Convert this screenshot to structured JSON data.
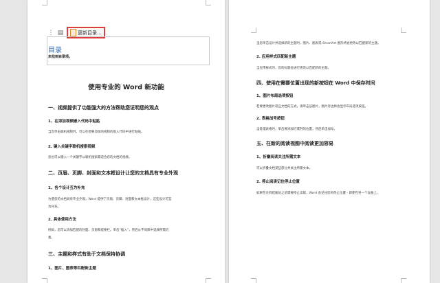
{
  "toc_toolbar": {
    "update_button_label": "更新目录..."
  },
  "toc": {
    "title": "目录",
    "empty_message": "未找到目录项。"
  },
  "left_page": {
    "doc_title": "使用专业的 Word 新功能",
    "lines": [
      {
        "type": "h1",
        "text": "一、视频提供了功能强大的方法帮助您证明您的观点"
      },
      {
        "type": "h2",
        "text": "1、在添加视频嵌入代码中粘贴"
      },
      {
        "type": "p",
        "text": "当您单击联机视频时，可以在想要添加的视频的嵌入代码中进行粘贴。"
      },
      {
        "type": "h2",
        "text": "2. 键入关键字联机搜索视频"
      },
      {
        "type": "p",
        "text": "您也可以键入一个关键字以联机搜索最适合您的文档的视频。"
      },
      {
        "type": "h1",
        "text": "二、页眉、页脚、封面和文本框设计让您的文档具有专业外观"
      },
      {
        "type": "h2",
        "text": "1、各个设计互为补充"
      },
      {
        "type": "p",
        "text": "为使您的文档具有专业外观，Word 提供了页眉、页脚、封面和文本框设计，这些设计可互"
      },
      {
        "type": "p",
        "text": "为补充。"
      },
      {
        "type": "h2",
        "text": "2. 具体使用方法"
      },
      {
        "type": "p",
        "text": "例如，您可以添加匹配的封面、页眉和提要栏。单击“插入”，然后从不同库中选择所需元"
      },
      {
        "type": "p",
        "text": "素。"
      },
      {
        "type": "h1",
        "text": "三、主题和样式有助于文档保持协调"
      },
      {
        "type": "h2",
        "text": "1、图片、图表等匹配新主题"
      }
    ]
  },
  "right_page": {
    "lines": [
      {
        "type": "p",
        "text": "当您单击设计并选择新的主题时，图片、图表或 SmartArt 图形将会更改以匹配新的主题。"
      },
      {
        "type": "h2",
        "text": "2. 应用样式匹配新主题"
      },
      {
        "type": "p",
        "text": "当应用样式时，您的标题会进行更改以匹配新的主题。"
      },
      {
        "type": "h1",
        "text": "四、使用在需要位置出现的新按钮在 Word 中保存时间"
      },
      {
        "type": "h2",
        "text": "1、图片布局选项按钮"
      },
      {
        "type": "p",
        "text": "若要更改图片适应文档的方式，请单击该图片，图片旁边将会显示布局选项按钮。"
      },
      {
        "type": "h2",
        "text": "2. 表格加号按钮"
      },
      {
        "type": "p",
        "text": "当处理表格时，单击要添加行或列的位置，然后单击加号。"
      },
      {
        "type": "h1",
        "text": "五、在新的阅读视图中阅读更加容易"
      },
      {
        "type": "h2",
        "text": "1、折叠阅读关注所需文本"
      },
      {
        "type": "p",
        "text": "可以折叠文档某些部分并关注所需文本。"
      },
      {
        "type": "h2",
        "text": "2. 停止阅读记住停止位置"
      },
      {
        "type": "p",
        "text": "如果在达到结尾处之前需要停止读取，Word 会记住您的停止位置 - 即使在另一个设备上。"
      }
    ]
  }
}
